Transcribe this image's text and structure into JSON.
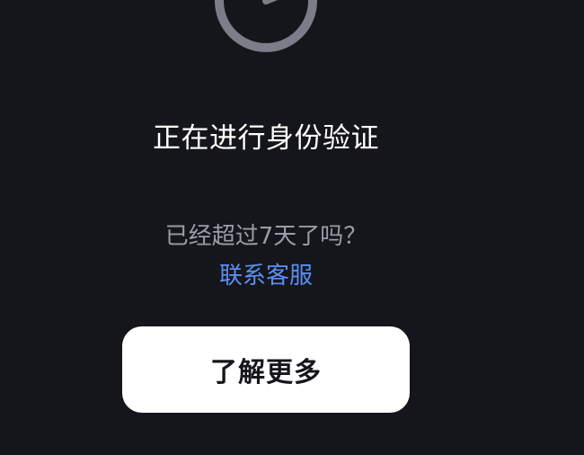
{
  "verification": {
    "title": "正在进行身份验证",
    "question": "已经超过7天了吗？",
    "support_link": "联系客服",
    "learn_more_button": "了解更多",
    "status_icon": "timer-icon"
  },
  "colors": {
    "background": "#15161b",
    "title_text": "#ffffff",
    "muted_text": "#9a9ca7",
    "link": "#5b8ff6",
    "icon_stroke": "#7c7d88",
    "button_bg": "#ffffff",
    "button_text": "#15161b"
  }
}
